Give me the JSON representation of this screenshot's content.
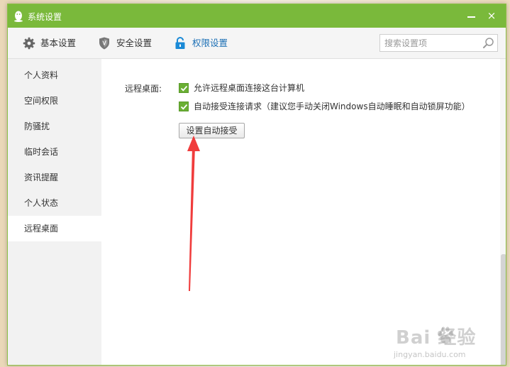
{
  "window": {
    "title": "系统设置",
    "minimize_label": "",
    "close_label": "×"
  },
  "toolbar": {
    "tabs": [
      {
        "label": "基本设置",
        "icon": "gear-icon"
      },
      {
        "label": "安全设置",
        "icon": "shield-icon"
      },
      {
        "label": "权限设置",
        "icon": "lock-icon",
        "active": true
      }
    ],
    "search": {
      "placeholder": "搜索设置项",
      "value": ""
    }
  },
  "sidebar": {
    "items": [
      {
        "label": "个人资料"
      },
      {
        "label": "空间权限"
      },
      {
        "label": "防骚扰"
      },
      {
        "label": "临时会话"
      },
      {
        "label": "资讯提醒"
      },
      {
        "label": "个人状态"
      },
      {
        "label": "远程桌面",
        "active": true
      }
    ]
  },
  "content": {
    "section_label": "远程桌面:",
    "options": [
      {
        "label": "允许远程桌面连接这台计算机",
        "checked": true
      },
      {
        "label": "自动接受连接请求（建议您手动关闭Windows自动睡眠和自动锁屏功能）",
        "checked": true
      }
    ],
    "auto_accept_button": "设置自动接受"
  },
  "watermark": {
    "brand": "Bai 经验",
    "url": "jingyan.baidu.com"
  },
  "colors": {
    "titlebar": "#7ab93b",
    "checkbox": "#6aaf33",
    "active_tab": "#1b6fb5",
    "annotation_arrow": "#f03c3c"
  }
}
